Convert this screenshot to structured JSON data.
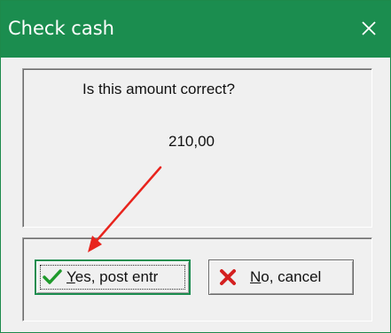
{
  "dialog": {
    "title": "Check cash",
    "message": "Is this amount correct?",
    "amount": "210,00"
  },
  "buttons": {
    "yes": {
      "mnemonic": "Y",
      "rest": "es, post entr"
    },
    "no": {
      "mnemonic": "N",
      "rest": "o, cancel"
    }
  },
  "colors": {
    "titlebar": "#1b8d4f",
    "annotation_arrow": "#e8241d",
    "check_icon": "#1f9a2c",
    "cross_icon": "#d42020"
  },
  "icons": [
    "close-icon",
    "check-icon",
    "cross-icon",
    "annotation-arrow"
  ]
}
